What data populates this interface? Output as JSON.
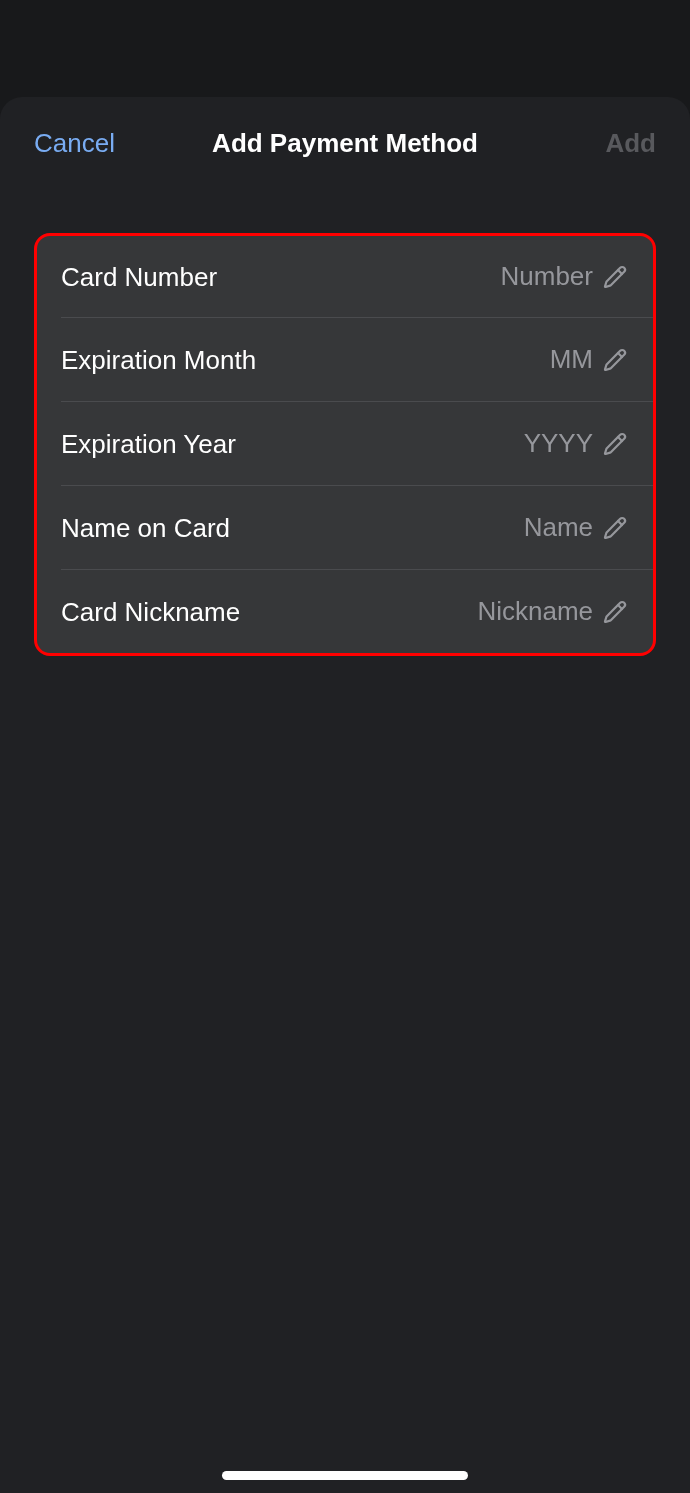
{
  "nav_bar": {
    "cancel": {
      "label": "Cancel"
    },
    "title": "Add Payment Method",
    "add": {
      "label": "Add",
      "disabled": true
    }
  },
  "form": {
    "highlighted": true,
    "fields": [
      {
        "label": "Card Number",
        "placeholder": "Number"
      },
      {
        "label": "Expiration Month",
        "placeholder": "MM"
      },
      {
        "label": "Expiration Year",
        "placeholder": "YYYY"
      },
      {
        "label": "Name on Card",
        "placeholder": "Name"
      },
      {
        "label": "Card Nickname",
        "placeholder": "Nickname"
      }
    ]
  }
}
